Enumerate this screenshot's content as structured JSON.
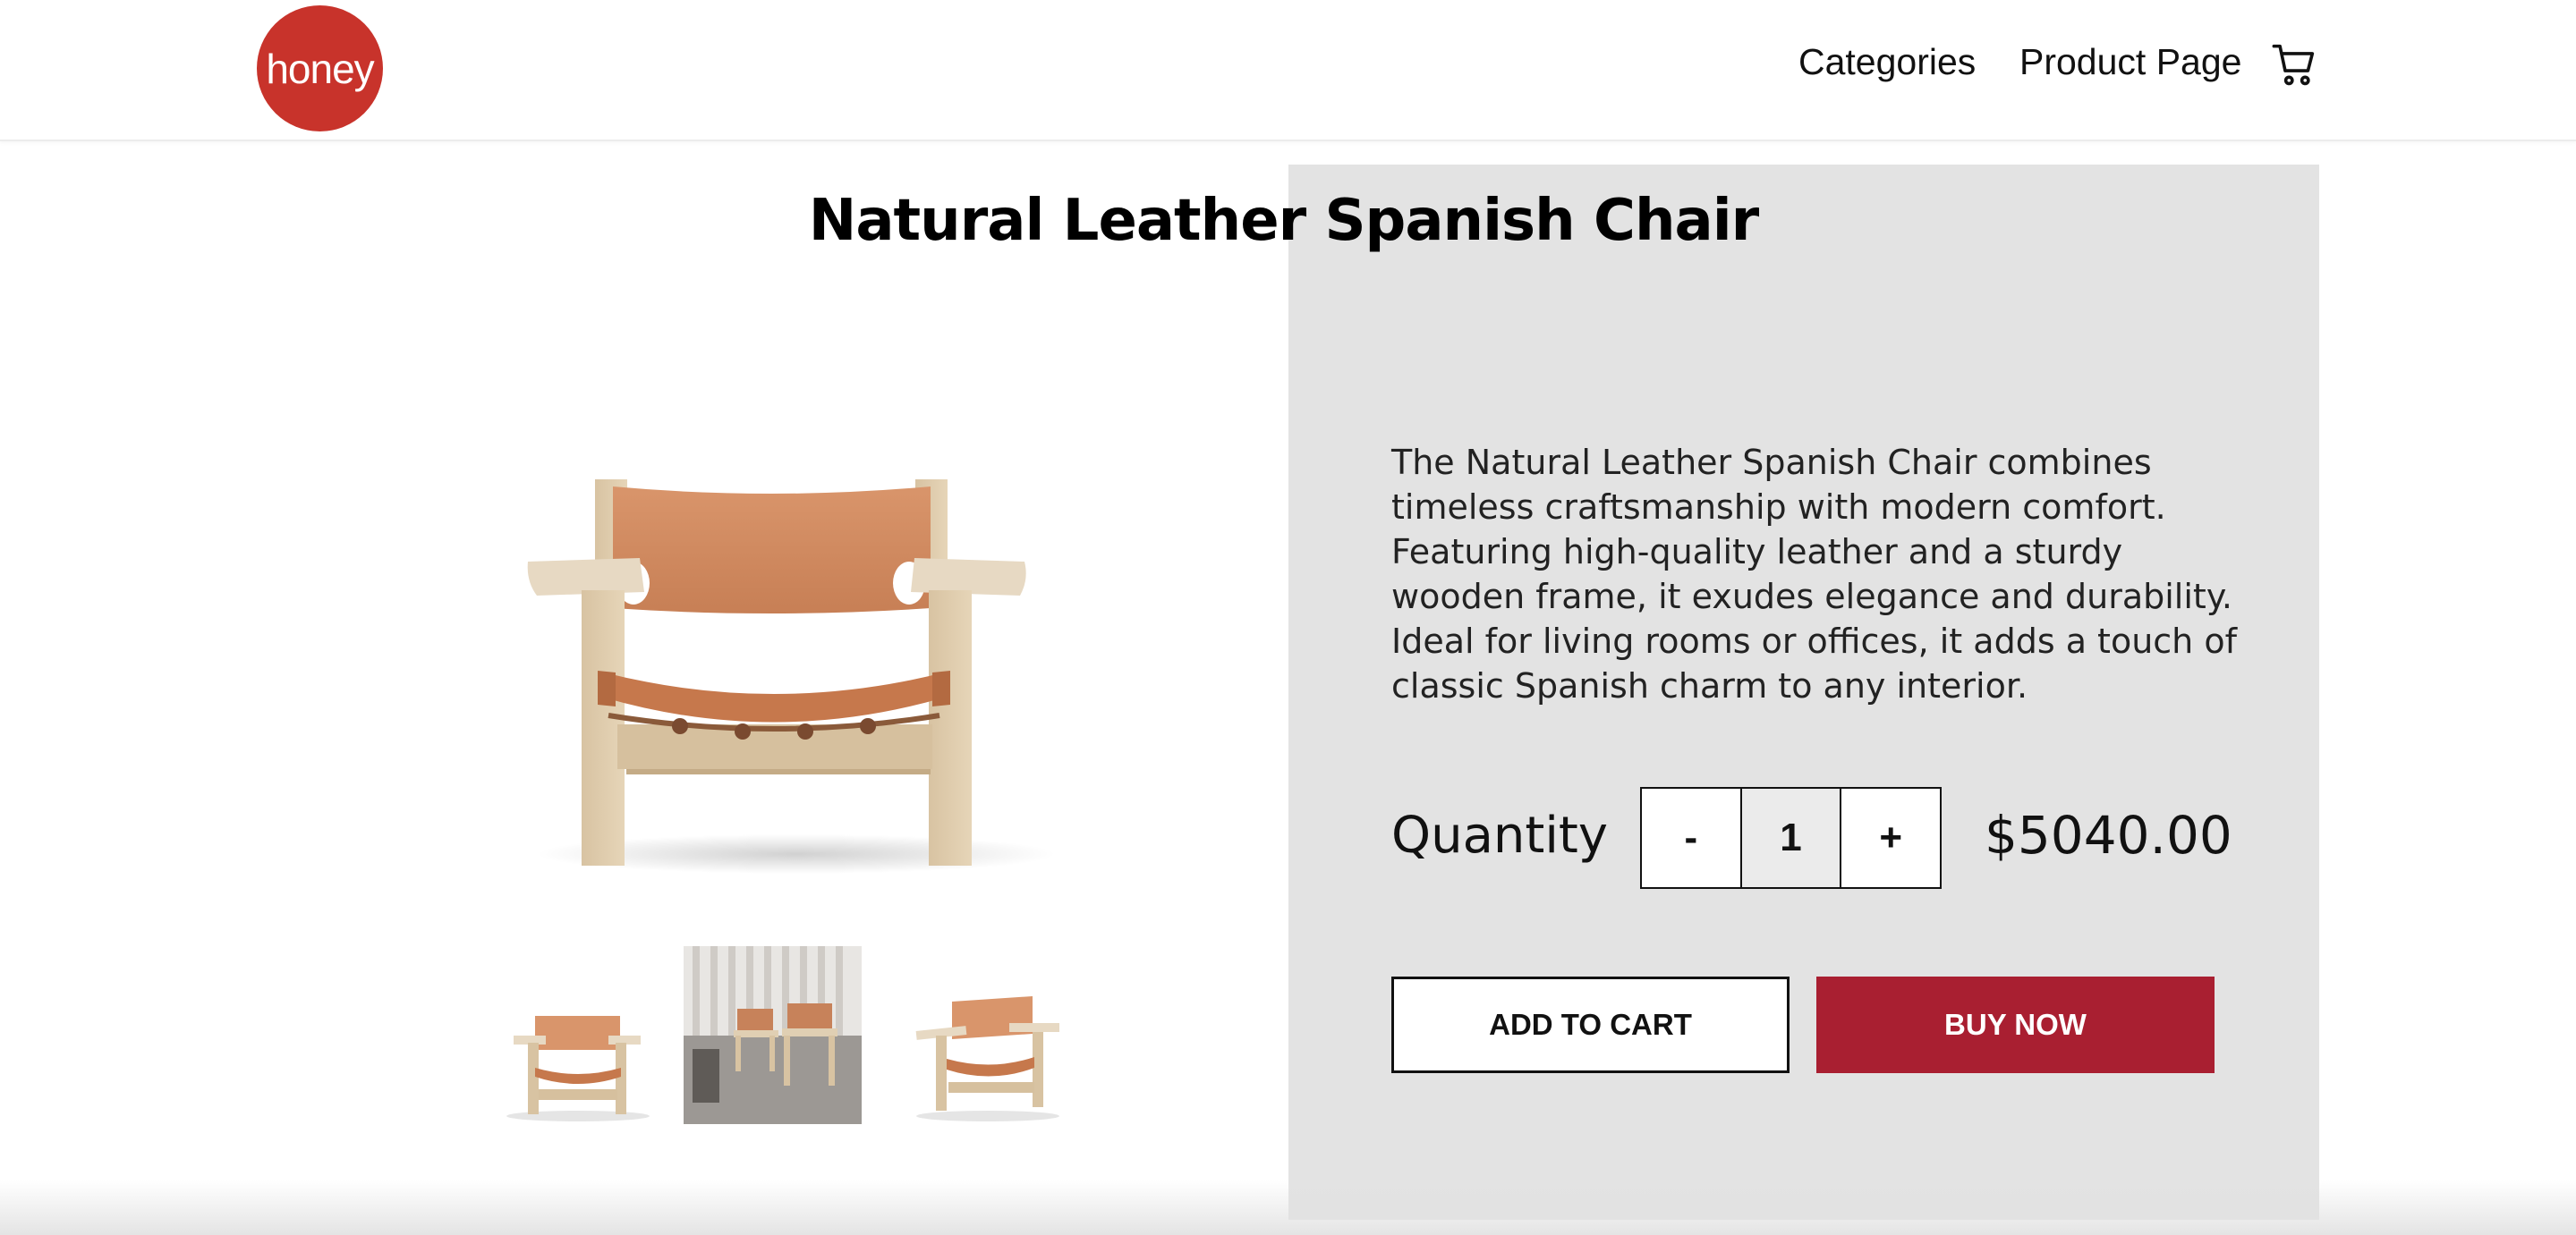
{
  "header": {
    "logo_text": "honey",
    "nav": {
      "categories": "Categories",
      "product_page": "Product Page"
    },
    "cart_icon": "shopping-cart-icon"
  },
  "product": {
    "title": "Natural Leather Spanish Chair",
    "description": "The Natural Leather Spanish Chair combines timeless craftsmanship with modern comfort. Featuring high-quality leather and a sturdy wooden frame, it exudes elegance and durability. Ideal for living rooms or offices, it adds a touch of classic Spanish charm to any interior.",
    "quantity_label": "Quantity",
    "quantity": {
      "minus": "-",
      "value": "1",
      "plus": "+"
    },
    "price": "$5040.00",
    "add_to_cart": "ADD TO CART",
    "buy_now": "BUY NOW"
  },
  "colors": {
    "brand": "#c8332b",
    "buy_button": "#a91f31",
    "panel": "#e3e3e3"
  },
  "images": {
    "main": "chair-front-image",
    "thumbnails": [
      "chair-front-thumb",
      "chairs-room-thumb",
      "chair-angle-thumb"
    ]
  }
}
